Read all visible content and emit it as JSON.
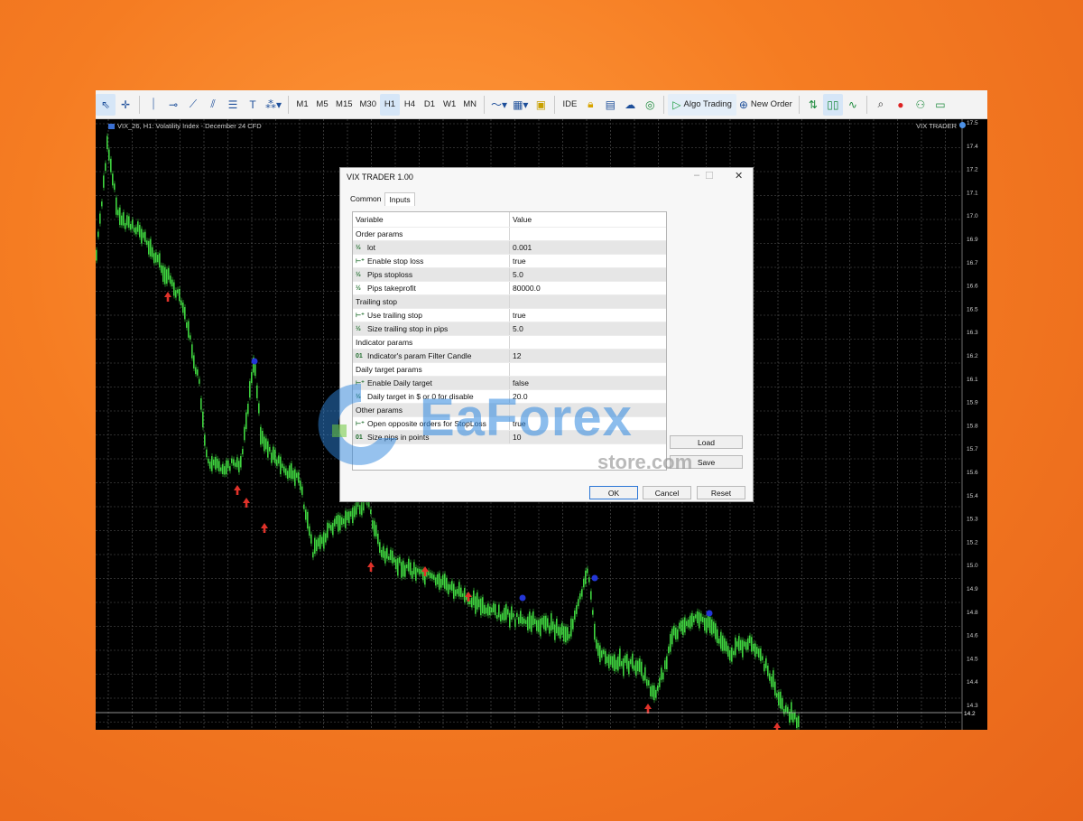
{
  "toolbar": {
    "timeframes": [
      "M1",
      "M5",
      "M15",
      "M30",
      "H1",
      "H4",
      "D1",
      "W1",
      "MN"
    ],
    "active_timeframe": "H1",
    "ide_label": "IDE",
    "algo_trading_label": "Algo Trading",
    "new_order_label": "New Order"
  },
  "chart": {
    "title": "VIX_26, H1:  Volatility Index - December 24 CFD",
    "ea_label": "VIX TRADER",
    "price_axis": [
      "17.5",
      "17.4",
      "17.2",
      "17.1",
      "17.0",
      "16.9",
      "16.7",
      "16.6",
      "16.5",
      "16.3",
      "16.2",
      "16.1",
      "15.9",
      "15.8",
      "15.7",
      "15.6",
      "15.4",
      "15.3",
      "15.2",
      "15.0",
      "14.9",
      "14.8",
      "14.6",
      "14.5",
      "14.4",
      "14.3"
    ],
    "current_price_label": "14.2"
  },
  "dialog": {
    "title": "VIX TRADER 1.00",
    "tabs": [
      "Common",
      "Inputs"
    ],
    "selected_tab": "Inputs",
    "header_variable": "Variable",
    "header_value": "Value",
    "rows": [
      {
        "kind": "section",
        "name": "Order params",
        "value": ""
      },
      {
        "kind": "num",
        "name": "lot",
        "value": "0.001"
      },
      {
        "kind": "bool",
        "name": "Enable stop loss",
        "value": "true"
      },
      {
        "kind": "num",
        "name": "Pips stoploss",
        "value": "5.0"
      },
      {
        "kind": "num",
        "name": "Pips takeprofit",
        "value": "80000.0"
      },
      {
        "kind": "section",
        "name": "Trailing stop",
        "value": ""
      },
      {
        "kind": "bool",
        "name": "Use trailing stop",
        "value": "true"
      },
      {
        "kind": "num",
        "name": "Size trailing stop in pips",
        "value": "5.0"
      },
      {
        "kind": "section",
        "name": "Indicator params",
        "value": ""
      },
      {
        "kind": "int",
        "name": "Indicator's param Filter Candle",
        "value": "12"
      },
      {
        "kind": "section",
        "name": "Daily target params",
        "value": ""
      },
      {
        "kind": "bool",
        "name": "Enable Daily target",
        "value": "false"
      },
      {
        "kind": "num",
        "name": "Daily target in $ or 0 for disable",
        "value": "20.0"
      },
      {
        "kind": "section",
        "name": "Other params",
        "value": ""
      },
      {
        "kind": "bool",
        "name": "Open opposite orders for StopLoss",
        "value": "true"
      },
      {
        "kind": "int",
        "name": "Size pips in points",
        "value": "10"
      }
    ],
    "load_label": "Load",
    "save_label": "Save",
    "ok_label": "OK",
    "cancel_label": "Cancel",
    "reset_label": "Reset"
  },
  "watermark": {
    "brand": "EaForex",
    "sub": "store.com"
  },
  "colors": {
    "bull_candle": "#3fd43f",
    "sell_arrow": "#e0322a",
    "buy_marker": "#2336d6",
    "grid": "#5a5a5a"
  }
}
